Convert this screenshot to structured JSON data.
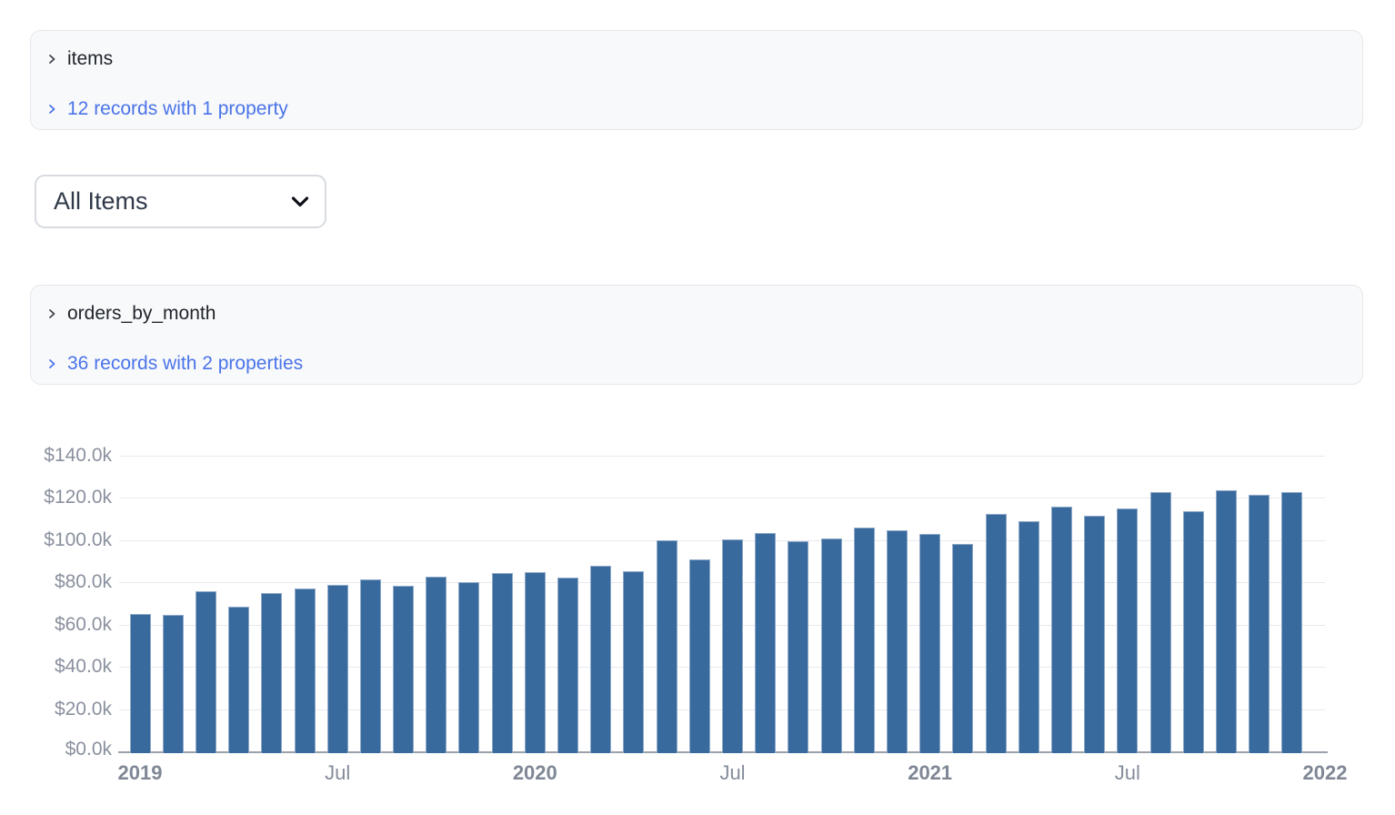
{
  "panels": {
    "items": {
      "title": "items",
      "records_label": "12 records with 1 property"
    },
    "orders": {
      "title": "orders_by_month",
      "records_label": "36 records with 2 properties"
    }
  },
  "filter": {
    "selected": "All Items"
  },
  "colors": {
    "bar_fill": "#386a9e",
    "bar_edge": "#8fa9c8",
    "link_blue": "#4a74e8",
    "panel_background": "#f8f9fb",
    "gridline": "#e8e9ee",
    "axis_line": "#9aa1ab",
    "axis_label": "#8a909e"
  },
  "icons": {
    "panel_chevron": "chevron-right",
    "link_chevron": "chevron-right",
    "dropdown_chevron": "chevron-down"
  },
  "chart_data": {
    "type": "bar",
    "title": "",
    "xlabel": "",
    "ylabel": "",
    "units": "USD thousands",
    "ylim": [
      0,
      140
    ],
    "grid": true,
    "legend": "none",
    "x": [
      "2019-01",
      "2019-02",
      "2019-03",
      "2019-04",
      "2019-05",
      "2019-06",
      "2019-07",
      "2019-08",
      "2019-09",
      "2019-10",
      "2019-11",
      "2019-12",
      "2020-01",
      "2020-02",
      "2020-03",
      "2020-04",
      "2020-05",
      "2020-06",
      "2020-07",
      "2020-08",
      "2020-09",
      "2020-10",
      "2020-11",
      "2020-12",
      "2021-01",
      "2021-02",
      "2021-03",
      "2021-04",
      "2021-05",
      "2021-06",
      "2021-07",
      "2021-08",
      "2021-09",
      "2021-10",
      "2021-11",
      "2021-12"
    ],
    "values": [
      65.0,
      64.7,
      75.9,
      68.5,
      74.9,
      77.0,
      78.9,
      81.3,
      78.4,
      82.8,
      80.3,
      84.3,
      85.0,
      82.4,
      87.9,
      85.5,
      99.8,
      90.9,
      100.6,
      103.4,
      99.6,
      100.7,
      105.9,
      104.6,
      102.9,
      98.1,
      112.4,
      109.2,
      115.7,
      111.5,
      115.0,
      122.8,
      113.8,
      123.6,
      121.6,
      122.6
    ],
    "y_ticks": [
      {
        "value": 0,
        "label": "$0.0k"
      },
      {
        "value": 20,
        "label": "$20.0k"
      },
      {
        "value": 40,
        "label": "$40.0k"
      },
      {
        "value": 60,
        "label": "$60.0k"
      },
      {
        "value": 80,
        "label": "$80.0k"
      },
      {
        "value": 100,
        "label": "$100.0k"
      },
      {
        "value": 120,
        "label": "$120.0k"
      },
      {
        "value": 140,
        "label": "$140.0k"
      }
    ],
    "x_ticks": [
      {
        "month_index": 0,
        "label": "2019",
        "bold": true
      },
      {
        "month_index": 6,
        "label": "Jul",
        "bold": false
      },
      {
        "month_index": 12,
        "label": "2020",
        "bold": true
      },
      {
        "month_index": 18,
        "label": "Jul",
        "bold": false
      },
      {
        "month_index": 24,
        "label": "2021",
        "bold": true
      },
      {
        "month_index": 30,
        "label": "Jul",
        "bold": false
      },
      {
        "month_index": 36,
        "label": "2022",
        "bold": true
      }
    ]
  }
}
